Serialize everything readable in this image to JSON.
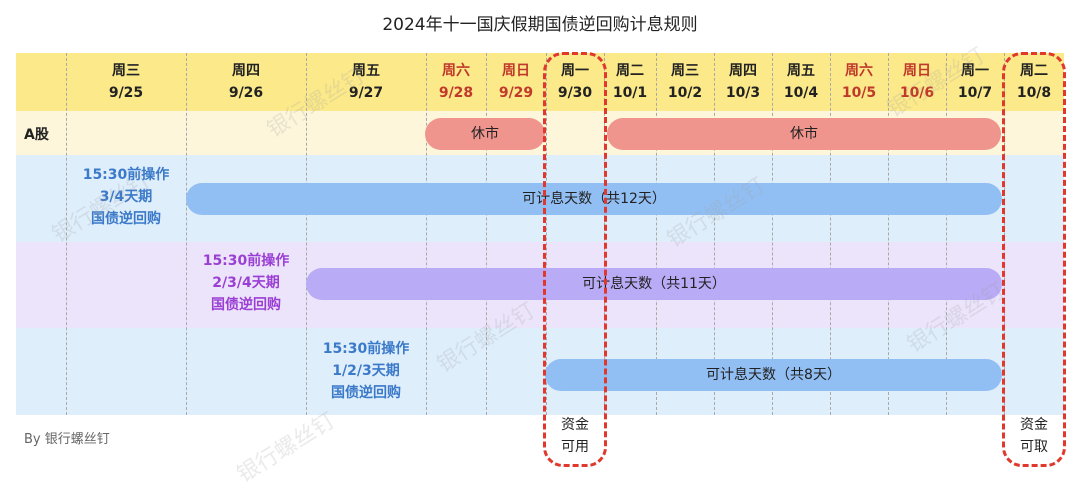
{
  "title": "2024年十一国庆假期国债逆回购计息规则",
  "columns": [
    {
      "weekday": "周三",
      "date": "9/25",
      "weekend": false
    },
    {
      "weekday": "周四",
      "date": "9/26",
      "weekend": false
    },
    {
      "weekday": "周五",
      "date": "9/27",
      "weekend": false
    },
    {
      "weekday": "周六",
      "date": "9/28",
      "weekend": true
    },
    {
      "weekday": "周日",
      "date": "9/29",
      "weekend": true
    },
    {
      "weekday": "周一",
      "date": "9/30",
      "weekend": false
    },
    {
      "weekday": "周二",
      "date": "10/1",
      "weekend": false
    },
    {
      "weekday": "周三",
      "date": "10/2",
      "weekend": false
    },
    {
      "weekday": "周四",
      "date": "10/3",
      "weekend": false
    },
    {
      "weekday": "周五",
      "date": "10/4",
      "weekend": false
    },
    {
      "weekday": "周六",
      "date": "10/5",
      "weekend": true
    },
    {
      "weekday": "周日",
      "date": "10/6",
      "weekend": true
    },
    {
      "weekday": "周一",
      "date": "10/7",
      "weekend": false
    },
    {
      "weekday": "周二",
      "date": "10/8",
      "weekend": false
    }
  ],
  "a_share": {
    "label": "A股",
    "closed_1": "休市",
    "closed_2": "休市"
  },
  "rows": [
    {
      "note": [
        "15:30前操作",
        "3/4天期",
        "国债逆回购"
      ],
      "bar": "可计息天数（共12天）"
    },
    {
      "note": [
        "15:30前操作",
        "2/3/4天期",
        "国债逆回购"
      ],
      "bar": "可计息天数（共11天）"
    },
    {
      "note": [
        "15:30前操作",
        "1/2/3天期",
        "国债逆回购"
      ],
      "bar": "可计息天数（共8天）"
    }
  ],
  "funds_available": [
    "资金",
    "可用"
  ],
  "funds_withdrawable": [
    "资金",
    "可取"
  ],
  "byline": "By 银行螺丝钉",
  "watermark": "银行螺丝钉",
  "colors": {
    "header_band": "#fbe98a",
    "closed_bar": "#f0958e",
    "interest_bar_blue": "#92bff3",
    "interest_bar_purple": "#b9abf5",
    "weekend_text": "#c0392b",
    "highlight_box": "#e0382c"
  }
}
